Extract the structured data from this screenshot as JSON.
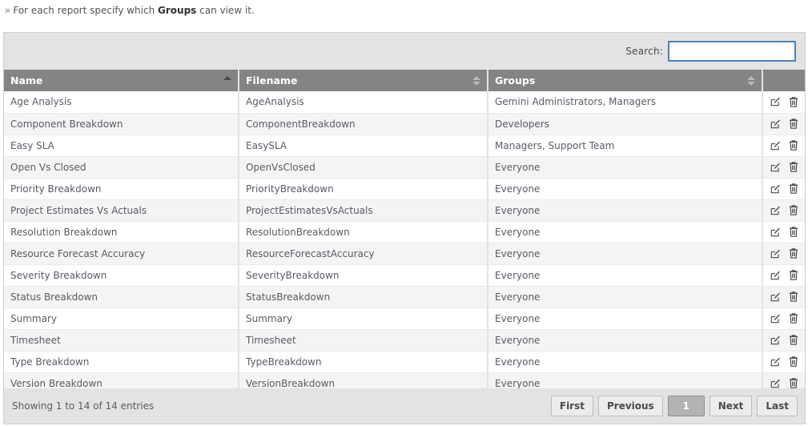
{
  "intro": {
    "bullet": "»",
    "prefix": "For each report specify which ",
    "emphasis": "Groups",
    "suffix": " can view it."
  },
  "search": {
    "label": "Search:",
    "value": "",
    "placeholder": ""
  },
  "table": {
    "columns": [
      {
        "label": "Name",
        "sort": "asc"
      },
      {
        "label": "Filename",
        "sort": "none"
      },
      {
        "label": "Groups",
        "sort": "none"
      },
      {
        "label": "",
        "sort": "none"
      }
    ],
    "row_icons": {
      "edit": "edit-icon",
      "delete": "trash-icon"
    },
    "rows": [
      {
        "name": "Age Analysis",
        "filename": "AgeAnalysis",
        "groups": "Gemini Administrators, Managers"
      },
      {
        "name": "Component Breakdown",
        "filename": "ComponentBreakdown",
        "groups": "Developers"
      },
      {
        "name": "Easy SLA",
        "filename": "EasySLA",
        "groups": "Managers, Support Team"
      },
      {
        "name": "Open Vs Closed",
        "filename": "OpenVsClosed",
        "groups": "Everyone"
      },
      {
        "name": "Priority Breakdown",
        "filename": "PriorityBreakdown",
        "groups": "Everyone"
      },
      {
        "name": "Project Estimates Vs Actuals",
        "filename": "ProjectEstimatesVsActuals",
        "groups": "Everyone"
      },
      {
        "name": "Resolution Breakdown",
        "filename": "ResolutionBreakdown",
        "groups": "Everyone"
      },
      {
        "name": "Resource Forecast Accuracy",
        "filename": "ResourceForecastAccuracy",
        "groups": "Everyone"
      },
      {
        "name": "Severity Breakdown",
        "filename": "SeverityBreakdown",
        "groups": "Everyone"
      },
      {
        "name": "Status Breakdown",
        "filename": "StatusBreakdown",
        "groups": "Everyone"
      },
      {
        "name": "Summary",
        "filename": "Summary",
        "groups": "Everyone"
      },
      {
        "name": "Timesheet",
        "filename": "Timesheet",
        "groups": "Everyone"
      },
      {
        "name": "Type Breakdown",
        "filename": "TypeBreakdown",
        "groups": "Everyone"
      },
      {
        "name": "Version Breakdown",
        "filename": "VersionBreakdown",
        "groups": "Everyone"
      }
    ]
  },
  "footer": {
    "info": "Showing 1 to 14 of 14 entries",
    "pager": [
      {
        "label": "First",
        "current": false
      },
      {
        "label": "Previous",
        "current": false
      },
      {
        "label": "1",
        "current": true
      },
      {
        "label": "Next",
        "current": false
      },
      {
        "label": "Last",
        "current": false
      }
    ]
  },
  "colors": {
    "header_bg": "#848484",
    "panel_bg": "#e3e3e3",
    "row_alt_bg": "#f4f4f4",
    "focus_border": "#4f81bd",
    "text": "#5a5a66"
  }
}
